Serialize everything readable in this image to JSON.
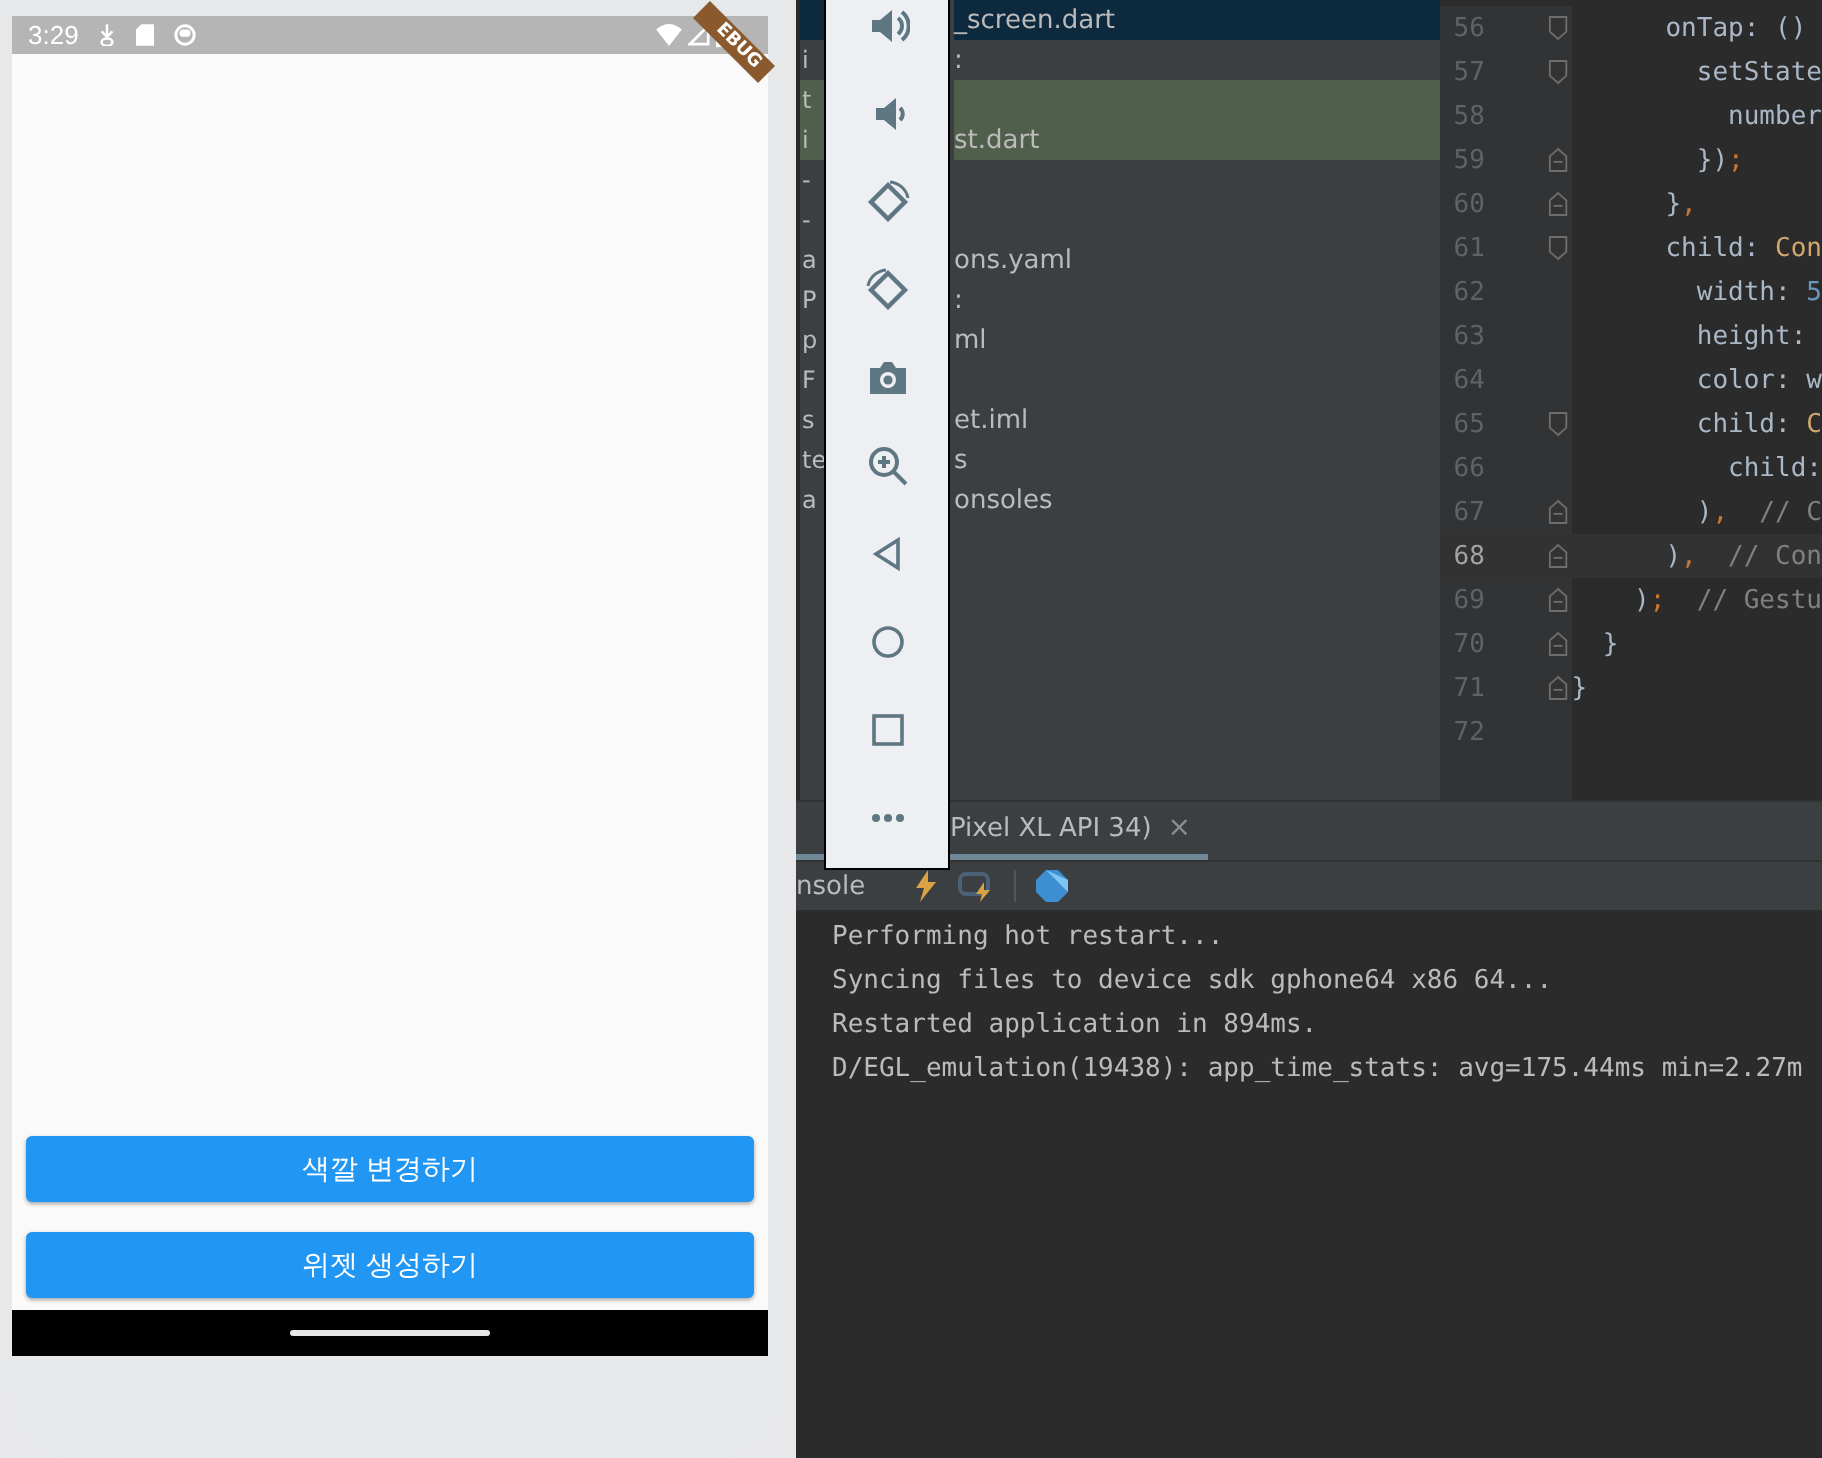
{
  "phone": {
    "status_bar": {
      "time": "3:29"
    },
    "debug_banner": "EBUG",
    "buttons": [
      {
        "label": "색깔 변경하기"
      },
      {
        "label": "위젯 생성하기"
      }
    ]
  },
  "project_tree": {
    "rows": [
      {
        "left": "",
        "right": "_screen.dart",
        "selected": true,
        "highlighted": false
      },
      {
        "left": "i",
        "right": ":",
        "selected": false,
        "highlighted": false
      },
      {
        "left": "t",
        "right": "",
        "selected": false,
        "highlighted": true
      },
      {
        "left": "i",
        "right": "st.dart",
        "selected": false,
        "highlighted": true
      },
      {
        "left": "-",
        "right": "",
        "selected": false,
        "highlighted": false
      },
      {
        "left": "-",
        "right": "",
        "selected": false,
        "highlighted": false
      },
      {
        "left": "a",
        "right": "ons.yaml",
        "selected": false,
        "highlighted": false
      },
      {
        "left": "P",
        "right": ":",
        "selected": false,
        "highlighted": false
      },
      {
        "left": "p",
        "right": "ml",
        "selected": false,
        "highlighted": false
      },
      {
        "left": "F",
        "right": "",
        "selected": false,
        "highlighted": false
      },
      {
        "left": "s",
        "right": "et.iml",
        "selected": false,
        "highlighted": false
      },
      {
        "left": "te",
        "right": "s",
        "selected": false,
        "highlighted": false
      },
      {
        "left": "a",
        "right": "onsoles",
        "selected": false,
        "highlighted": false
      }
    ]
  },
  "editor": {
    "lines": [
      {
        "number": "56",
        "kind": "fold-start",
        "current": false,
        "tokens": [
          {
            "t": "      onTap: ()",
            "color": "#a9b7c6"
          }
        ]
      },
      {
        "number": "57",
        "kind": "fold-start",
        "current": false,
        "tokens": [
          {
            "t": "        setState",
            "color": "#a9b7c6"
          }
        ]
      },
      {
        "number": "58",
        "kind": "plain",
        "current": false,
        "tokens": [
          {
            "t": "          number",
            "color": "#a9b7c6"
          }
        ]
      },
      {
        "number": "59",
        "kind": "fold-end",
        "current": false,
        "tokens": [
          {
            "t": "        })",
            "color": "#a9b7c6"
          },
          {
            "t": ";",
            "color": "#cc7832"
          }
        ]
      },
      {
        "number": "60",
        "kind": "fold-end",
        "current": false,
        "tokens": [
          {
            "t": "      }",
            "color": "#a9b7c6"
          },
          {
            "t": ",",
            "color": "#cc7832"
          }
        ]
      },
      {
        "number": "61",
        "kind": "fold-start",
        "current": false,
        "tokens": [
          {
            "t": "      child: ",
            "color": "#a9b7c6"
          },
          {
            "t": "Con",
            "color": "#d0a66c"
          }
        ]
      },
      {
        "number": "62",
        "kind": "plain",
        "current": false,
        "tokens": [
          {
            "t": "        width: ",
            "color": "#a9b7c6"
          },
          {
            "t": "5",
            "color": "#6897bb"
          }
        ]
      },
      {
        "number": "63",
        "kind": "plain",
        "current": false,
        "tokens": [
          {
            "t": "        height:",
            "color": "#a9b7c6"
          }
        ]
      },
      {
        "number": "64",
        "kind": "plain",
        "current": false,
        "tokens": [
          {
            "t": "        color: w",
            "color": "#a9b7c6"
          }
        ]
      },
      {
        "number": "65",
        "kind": "fold-start",
        "current": false,
        "tokens": [
          {
            "t": "        child: ",
            "color": "#a9b7c6"
          },
          {
            "t": "C",
            "color": "#d0a66c"
          }
        ]
      },
      {
        "number": "66",
        "kind": "plain",
        "current": false,
        "tokens": [
          {
            "t": "          child:",
            "color": "#a9b7c6"
          }
        ]
      },
      {
        "number": "67",
        "kind": "fold-end",
        "current": false,
        "tokens": [
          {
            "t": "        )",
            "color": "#a9b7c6"
          },
          {
            "t": ",",
            "color": "#cc7832"
          },
          {
            "t": "  // C",
            "color": "#808080"
          }
        ]
      },
      {
        "number": "68",
        "kind": "fold-end",
        "current": true,
        "tokens": [
          {
            "t": "      )",
            "color": "#a9b7c6"
          },
          {
            "t": ",",
            "color": "#cc7832"
          },
          {
            "t": "  // Con",
            "color": "#808080"
          }
        ]
      },
      {
        "number": "69",
        "kind": "fold-end",
        "current": false,
        "tokens": [
          {
            "t": "    )",
            "color": "#a9b7c6"
          },
          {
            "t": ";",
            "color": "#cc7832"
          },
          {
            "t": "  // Gestu",
            "color": "#808080"
          }
        ]
      },
      {
        "number": "70",
        "kind": "fold-end",
        "current": false,
        "tokens": [
          {
            "t": "  }",
            "color": "#a9b7c6"
          }
        ]
      },
      {
        "number": "71",
        "kind": "fold-end",
        "current": false,
        "tokens": [
          {
            "t": "}",
            "color": "#a9b7c6"
          }
        ]
      },
      {
        "number": "72",
        "kind": "plain",
        "current": false
      }
    ]
  },
  "run_panel": {
    "tabs": [
      {
        "label": "Pixel XL API 34)",
        "close": "×",
        "selected": true
      }
    ],
    "toolbar_label": "nsole",
    "console": [
      "Performing hot restart...",
      "Syncing files to device sdk gphone64 x86 64...",
      "Restarted application in 894ms.",
      "D/EGL_emulation(19438): app_time_stats: avg=175.44ms min=2.27m"
    ]
  }
}
